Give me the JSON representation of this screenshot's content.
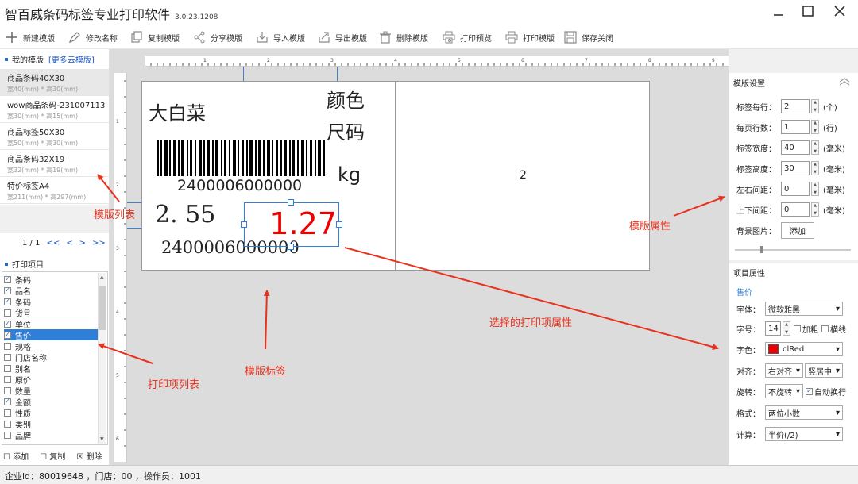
{
  "window": {
    "title": "智百威条码标签专业打印软件",
    "version": "3.0.23.1208"
  },
  "toolbar": {
    "new": "新建模版",
    "rename": "修改名称",
    "copy": "复制模版",
    "share": "分享模版",
    "import": "导入模版",
    "export": "导出模版",
    "delete": "删除模版",
    "preview": "打印预览",
    "print": "打印模版",
    "save_close": "保存关闭"
  },
  "left": {
    "my_templates": "我的模版",
    "more_cloud": "[更多云模版]",
    "templates": [
      {
        "name": "商品条码40X30",
        "size": "宽40(mm) * 高30(mm)"
      },
      {
        "name": "wow商品条码-231007113",
        "size": "宽30(mm) * 高15(mm)"
      },
      {
        "name": "商品标签50X30",
        "size": "宽50(mm) * 高30(mm)"
      },
      {
        "name": "商品条码32X19",
        "size": "宽32(mm) * 高19(mm)"
      },
      {
        "name": "特价标签A4",
        "size": "宽211(mm) * 高297(mm)"
      }
    ],
    "pager": {
      "page": "1 / 1",
      "first": "<<",
      "prev": "<",
      "next": ">",
      "last": ">>"
    },
    "print_items_title": "打印项目",
    "print_items": [
      {
        "label": "条码",
        "checked": true
      },
      {
        "label": "品名",
        "checked": true
      },
      {
        "label": "条码",
        "checked": true
      },
      {
        "label": "货号",
        "checked": false
      },
      {
        "label": "单位",
        "checked": true
      },
      {
        "label": "售价",
        "checked": true
      },
      {
        "label": "规格",
        "checked": false
      },
      {
        "label": "门店名称",
        "checked": false
      },
      {
        "label": "别名",
        "checked": false
      },
      {
        "label": "原价",
        "checked": false
      },
      {
        "label": "数量",
        "checked": false
      },
      {
        "label": "金额",
        "checked": true
      },
      {
        "label": "性质",
        "checked": false
      },
      {
        "label": "类别",
        "checked": false
      },
      {
        "label": "品牌",
        "checked": false
      }
    ],
    "add": "添加",
    "copy": "复制",
    "delete": "删除"
  },
  "canvas": {
    "label": {
      "name": "大白菜",
      "color": "颜色",
      "size": "尺码",
      "barcode_text": "2400006000000",
      "unit": "kg",
      "price_old": "2. 55",
      "price_sel": "1.27",
      "code_bottom": "2400006000000"
    },
    "label2_text": "2"
  },
  "template_settings": {
    "title": "模版设置",
    "per_row_label": "标签每行：",
    "per_row": "2",
    "per_row_unit": "(个)",
    "rows_label": "每页行数：",
    "rows": "1",
    "rows_unit": "(行)",
    "width_label": "标签宽度：",
    "width": "40",
    "width_unit": "(毫米)",
    "height_label": "标签高度：",
    "height": "30",
    "height_unit": "(毫米)",
    "lr_label": "左右间距：",
    "lr": "0",
    "lr_unit": "(毫米)",
    "tb_label": "上下间距：",
    "tb": "0",
    "tb_unit": "(毫米)",
    "bg_label": "背景图片：",
    "bg_button": "添加"
  },
  "item_props": {
    "title": "项目属性",
    "item_name": "售价",
    "font_label": "字体：",
    "font": "微软雅黑",
    "size_label": "字号：",
    "size": "14",
    "bold": "加粗",
    "underline": "横线",
    "color_label": "字色：",
    "color": "clRed",
    "color_hex": "#ee0000",
    "align_label": "对齐：",
    "halign": "右对齐",
    "valign": "竖居中",
    "rotate_label": "旋转：",
    "rotate": "不旋转",
    "wrap": "自动换行",
    "format_label": "格式：",
    "format": "两位小数",
    "calc_label": "计算：",
    "calc": "半价(/2)"
  },
  "annotations": {
    "template_list": "模版列表",
    "template_props": "模版属性",
    "selected_props": "选择的打印项属性",
    "template_label": "模版标签",
    "print_list": "打印项列表"
  },
  "status": "企业id：80019648 ，门店：00 ，操作员：1001",
  "colors": {
    "accent": "#2f7fd8",
    "annotation": "#e8321e",
    "price": "#ee0000"
  }
}
